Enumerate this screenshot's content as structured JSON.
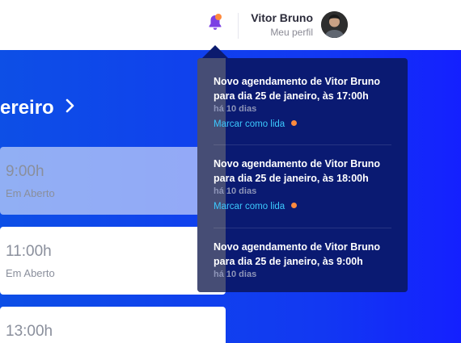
{
  "header": {
    "user": {
      "name": "Vitor Bruno",
      "profile_link": "Meu perfil"
    },
    "icons": {
      "notifications": "bell-icon",
      "unread_indicator": "orange-dot"
    }
  },
  "calendar": {
    "month_label": "ereiro",
    "slots": [
      {
        "time": "9:00h",
        "status": "Em Aberto"
      },
      {
        "time": "11:00h",
        "status": "Em Aberto"
      },
      {
        "time": "13:00h",
        "status": ""
      }
    ]
  },
  "notifications": [
    {
      "message": "Novo agendamento de Vitor Bruno para dia 25 de janeiro, às 17:00h",
      "time": "há 10 dias",
      "action": "Marcar como lida",
      "unread": true
    },
    {
      "message": "Novo agendamento de Vitor Bruno para dia 25 de janeiro, às 18:00h",
      "time": "há 10 dias",
      "action": "Marcar como lida",
      "unread": true
    },
    {
      "message": "Novo agendamento de Vitor Bruno para dia 25 de janeiro, às 9:00h",
      "time": "há 10 dias",
      "action": "",
      "unread": false
    }
  ],
  "colors": {
    "accent_blue": "#1238f2",
    "popover_bg": "#0a1a72",
    "link": "#3cc9ff",
    "unread_dot": "#ff8a3d",
    "bell": "#7b3fe4"
  }
}
